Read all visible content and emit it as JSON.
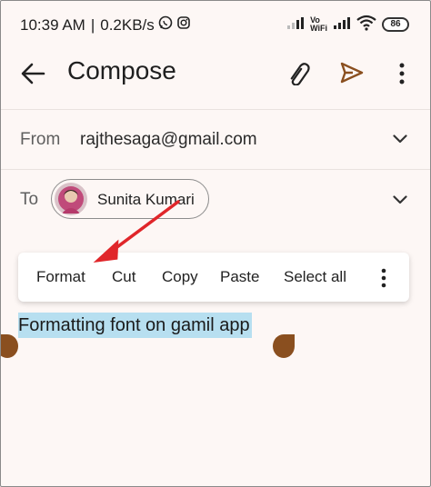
{
  "status_bar": {
    "time": "10:39 AM",
    "separator": "|",
    "speed": "0.2KB/s",
    "vowifi_line1": "Vo",
    "vowifi_line2": "WiFi",
    "battery": "86"
  },
  "app_bar": {
    "title": "Compose"
  },
  "from": {
    "label": "From",
    "value": "rajthesaga@gmail.com"
  },
  "to": {
    "label": "To",
    "recipient": "Sunita Kumari"
  },
  "context_menu": {
    "items": [
      "Format",
      "Cut",
      "Copy",
      "Paste",
      "Select all"
    ]
  },
  "body": {
    "text": "Formatting font on gamil app"
  },
  "colors": {
    "background": "#fdf7f5",
    "selection": "#b7dff0",
    "handle": "#8a4f1f",
    "send_icon": "#8a4f1f",
    "annotation_arrow": "#e0262a"
  }
}
